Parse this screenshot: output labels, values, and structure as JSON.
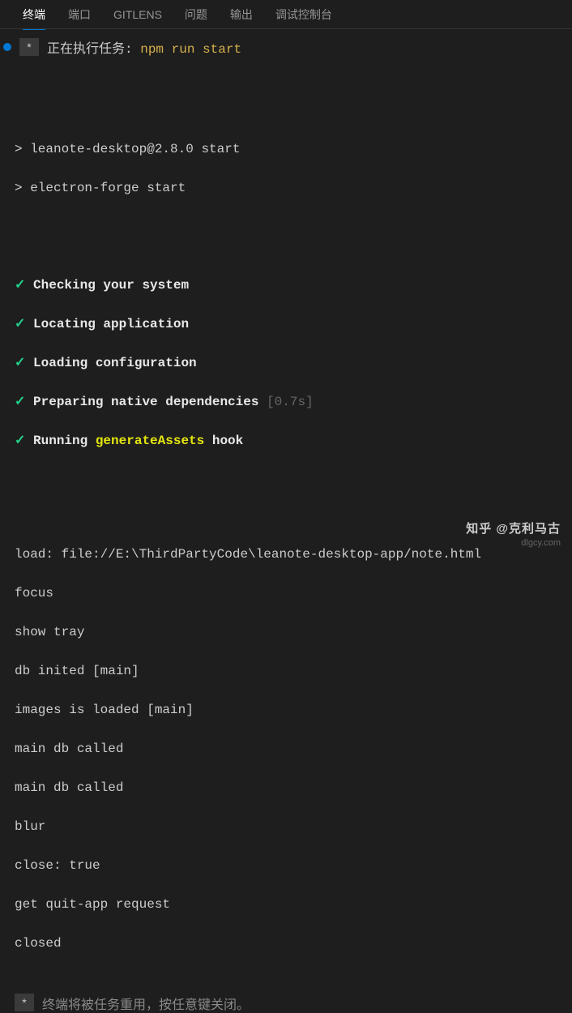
{
  "tabs": {
    "terminal": "终端",
    "ports": "端口",
    "gitlens": "GITLENS",
    "problems": "问题",
    "output": "输出",
    "debug": "调试控制台"
  },
  "task": {
    "star": "*",
    "label": "正在执行任务: ",
    "command": "npm run start"
  },
  "npm": {
    "line1": "> leanote-desktop@2.8.0 start",
    "line2": "> electron-forge start"
  },
  "steps": {
    "s1": "Checking your system",
    "s2": "Locating application",
    "s3": "Loading configuration",
    "s4": "Preparing native dependencies",
    "s4time": "[0.7s]",
    "s5a": "Running ",
    "s5b": "generateAssets",
    "s5c": " hook"
  },
  "logs": {
    "l1": "load: file://E:\\ThirdPartyCode\\leanote-desktop-app/note.html",
    "l2": "focus",
    "l3": "show tray",
    "l4": "db inited [main]",
    "l5": "images is loaded [main]",
    "l6": "main db called",
    "l7": "main db called",
    "l8": "blur",
    "l9": "close: true",
    "l10": "get quit-app request",
    "l11": "closed"
  },
  "footer": {
    "star": "*",
    "text": "终端将被任务重用，按任意键关闭。"
  },
  "watermark": {
    "main": "知乎 @克利马古",
    "sub": "dlgcy.com"
  }
}
